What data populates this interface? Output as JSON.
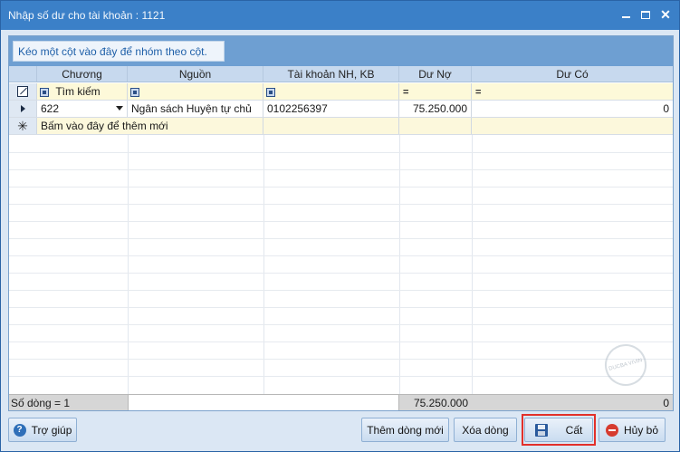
{
  "window": {
    "title": "Nhập số dư cho tài khoản : 1121",
    "controls": {
      "minimize_icon": "minimize-icon",
      "maximize_icon": "maximize-icon",
      "close_icon": "close-icon",
      "close_symbol": "✕"
    }
  },
  "group_panel": {
    "hint": "Kéo một cột vào đây để nhóm theo cột."
  },
  "grid": {
    "columns": [
      "Chương",
      "Nguồn",
      "Tài khoản NH, KB",
      "Dư Nợ",
      "Dư Có"
    ],
    "filter_row": {
      "search_placeholder": "Tìm kiếm",
      "equals_symbol": "="
    },
    "rows": [
      {
        "chuong": "622",
        "nguon": "Ngân sách Huyện tự chủ",
        "tai_khoan": "0102256397",
        "du_no": "75.250.000",
        "du_co": "0"
      }
    ],
    "new_row_text": "Bấm vào đây để thêm mới",
    "new_row_symbol": "✳",
    "footer": {
      "row_count": "Số dòng = 1",
      "total_du_no": "75.250.000",
      "total_du_co": "0"
    }
  },
  "watermark_text": "DUCBA VIVIN",
  "buttons": {
    "help": "Trợ giúp",
    "add_row": "Thêm dòng mới",
    "delete_row": "Xóa dòng",
    "save": "Cất",
    "cancel": "Hủy bỏ"
  },
  "colors": {
    "titlebar": "#3b80c8",
    "highlight_border": "#e2302a",
    "filter_row_bg": "#fdf9d9"
  }
}
